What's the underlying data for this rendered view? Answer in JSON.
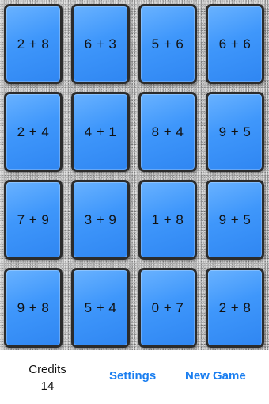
{
  "cards": [
    [
      "2 + 8",
      "6 + 3",
      "5 + 6",
      "6 + 6"
    ],
    [
      "2 + 4",
      "4 + 1",
      "8 + 4",
      "9 + 5"
    ],
    [
      "7 + 9",
      "3 + 9",
      "1 + 8",
      "9 + 5"
    ],
    [
      "9 + 8",
      "5 + 4",
      "0 + 7",
      "2 + 8"
    ]
  ],
  "footer": {
    "credits_label": "Credits",
    "credits_value": "14",
    "settings_label": "Settings",
    "new_game_label": "New Game"
  },
  "colors": {
    "card_blue": "#3f97fb",
    "link_blue": "#1a7ef0",
    "board_gray": "#b9b9b9"
  }
}
